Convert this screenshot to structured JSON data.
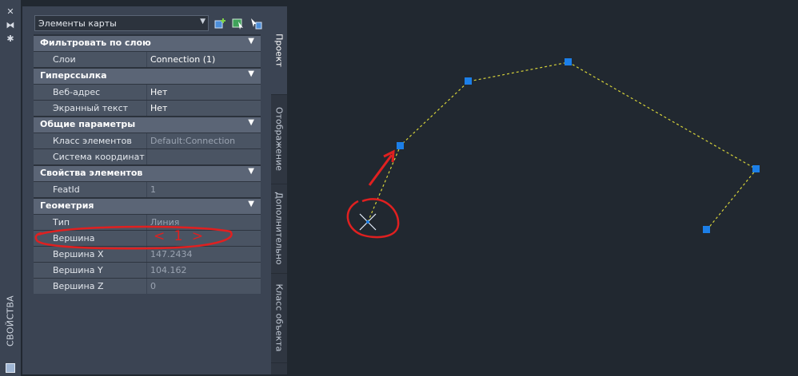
{
  "palette": {
    "vertex": "#1c7fe8",
    "polyline": "#d6d23a",
    "annotation": "#e02020"
  },
  "strip": {
    "title": "СВОЙСТВА",
    "icons": [
      "close-icon",
      "auto-hide-icon",
      "gear-icon",
      "save-icon"
    ]
  },
  "toolbar": {
    "dropdown_value": "Элементы карты",
    "icons": [
      "quick-select-icon",
      "select-objects-icon",
      "toggle-pickadd-icon"
    ]
  },
  "grid": {
    "filter": {
      "title": "Фильтровать по слою",
      "layers_label": "Слои",
      "layers_value": "Connection (1)"
    },
    "hyperlink": {
      "title": "Гиперссылка",
      "web_label": "Веб-адрес",
      "web_value": "Нет",
      "screen_label": "Экранный текст",
      "screen_value": "Нет"
    },
    "general": {
      "title": "Общие параметры",
      "class_label": "Класс элементов",
      "class_value": "Default:Connection",
      "cs_label": "Система координат",
      "cs_value": ""
    },
    "feature": {
      "title": "Свойства элементов",
      "featid_label": "FeatId",
      "featid_value": "1"
    },
    "geometry": {
      "title": "Геометрия",
      "type_label": "Тип",
      "type_value": "Линия",
      "vertex_label": "Вершина",
      "vertex_value": "< 1 >",
      "vx_label": "Вершина X",
      "vx_value": "147.2434",
      "vy_label": "Вершина Y",
      "vy_value": "104.162",
      "vz_label": "Вершина Z",
      "vz_value": "0"
    }
  },
  "tabs": {
    "project": "Проект",
    "display": "Отображение",
    "additional": "Дополнительно",
    "object_class": "Класс объекта"
  }
}
